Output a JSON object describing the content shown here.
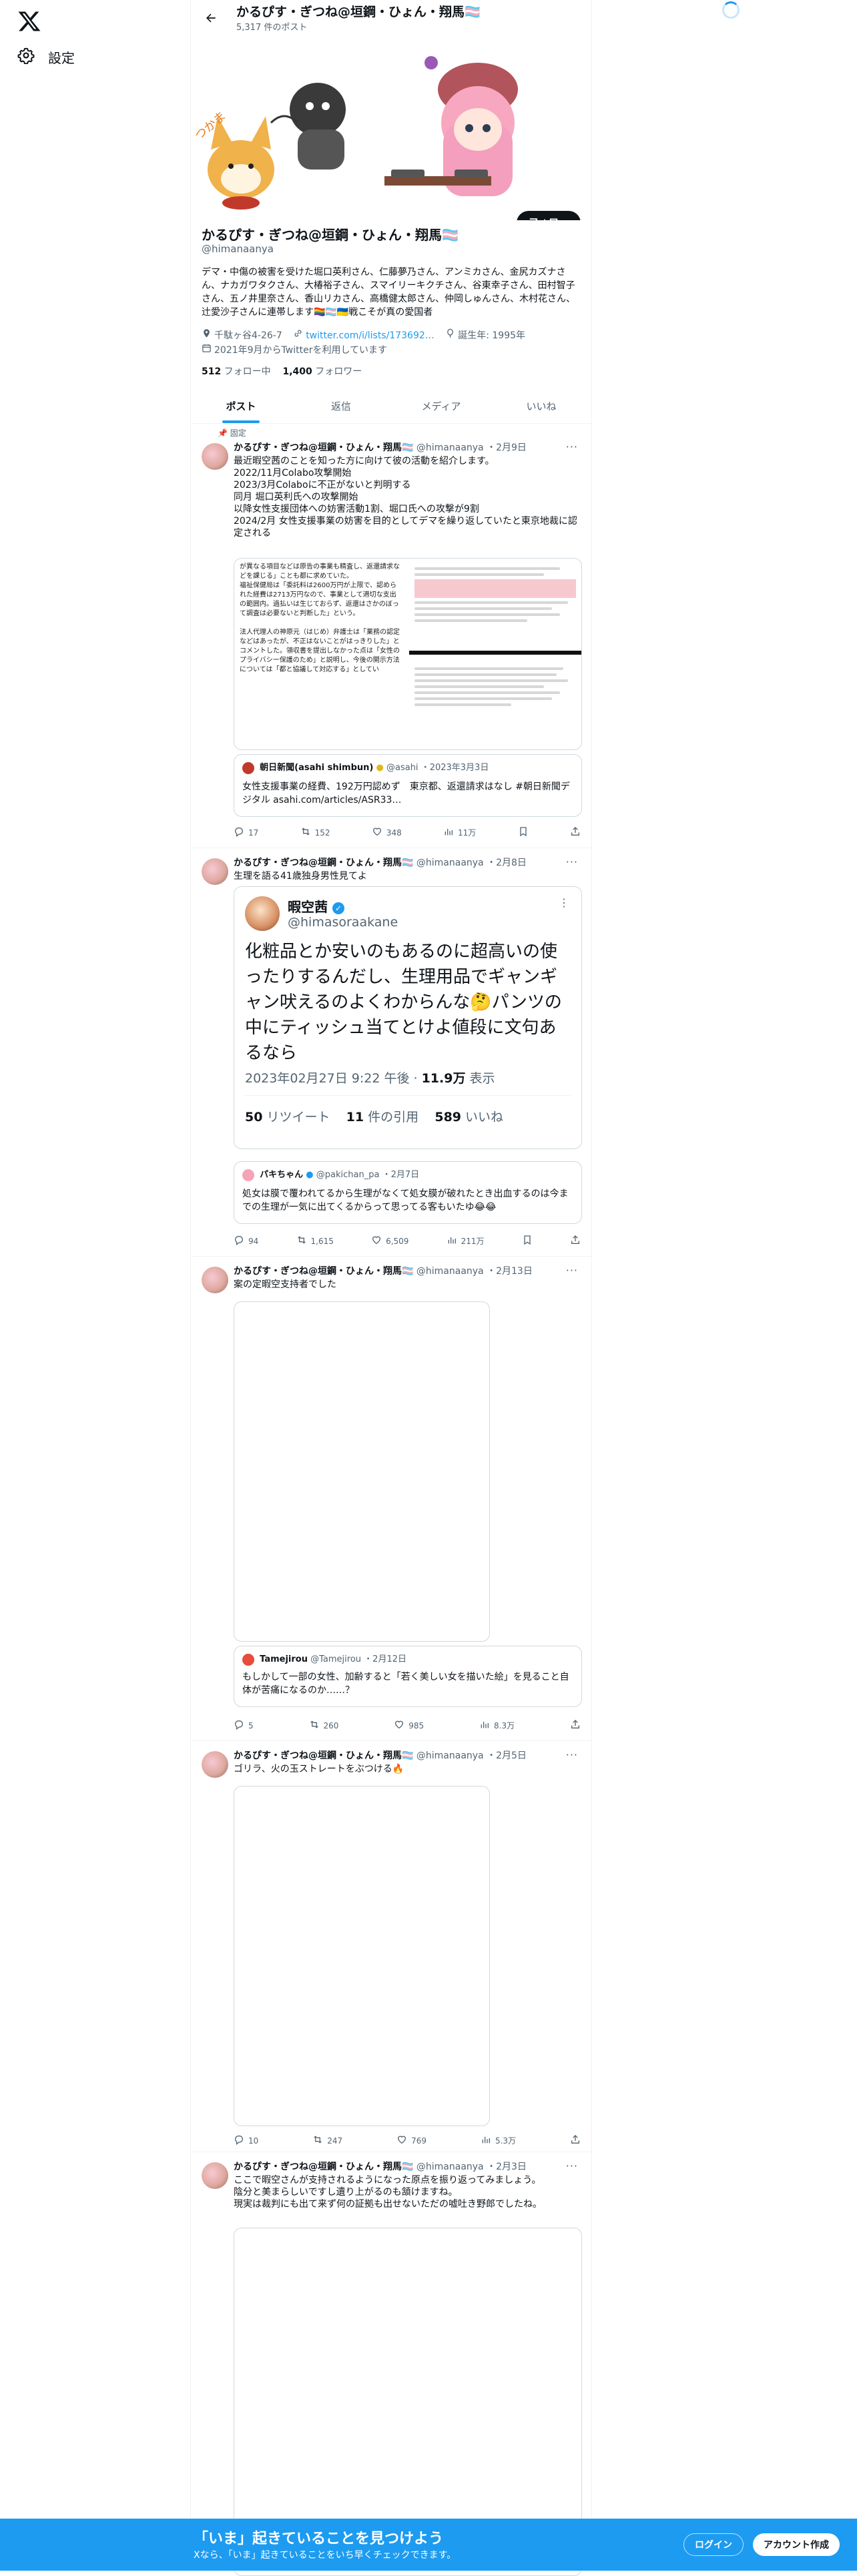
{
  "nav": {
    "settings_label": "設定"
  },
  "header": {
    "name": "かるぴす・ぎつね@垣鋼・ひょん・翔馬🏳️‍⚧️",
    "post_count": "5,317 件のポスト"
  },
  "profile": {
    "name": "かるぴす・ぎつね@垣鋼・ひょん・翔馬🏳️‍⚧️",
    "handle": "@himanaanya",
    "follow_label": "フォロー",
    "bio": "デマ・中傷の被害を受けた堀口英利さん、仁藤夢乃さん、アンミカさん、金尻カズナさん、ナカガワタクさん、大椿裕子さん、スマイリーキクチさん、谷東幸子さん、田村智子さん、五ノ井里奈さん、香山リカさん、高橋健太郎さん、仲岡しゅんさん、木村花さん、辻愛沙子さんに連帯します🏳️‍🌈🏳️‍⚧️🇺🇦戦こそが真の愛国者",
    "location": "千駄ヶ谷4-26-7",
    "website": "twitter.com/i/lists/173692…",
    "birthday": "誕生年: 1995年",
    "joined": "2021年9月からTwitterを利用しています",
    "following_count": "512",
    "following_label": " フォロー中",
    "followers_count": "1,400",
    "followers_label": " フォロワー"
  },
  "tabs": [
    "ポスト",
    "返信",
    "メディア",
    "いいね"
  ],
  "tweets": [
    {
      "pinned_label": "固定",
      "name": "かるぴす・ぎつね@垣鋼・ひょん・翔馬🏳️‍⚧️",
      "handle": "@himanaanya",
      "date": "・2月9日",
      "text": "最近暇空茜のことを知った方に向けて彼の活動を紹介します。\n2022/11月Colabo攻撃開始\n2023/3月Colaboに不正がないと判明する\n同月 堀口英利氏への攻撃開始\n以降女性支援団体への妨害活動1割、堀口氏への攻撃が9割\n2024/2月 女性支援事業の妨害を目的としてデマを繰り返していたと東京地裁に認定される",
      "media_left_text": "が異なる項目などは原告の事業も精査し、返還請求などを課じる」ことも都に求めていた。\n福祉保健局は「委託料は2600万円が上限で、認められた経費は2713万円なので、事業として適切な支出の範囲内。過払いは生じておらず、返還はさかのぼって調査は必要ないと判断した」という。\n\n法人代理人の神原元（はじめ）弁護士は「業務の認定などはあったが、不正はないことがはっきりした」とコメントした。領収書を提出しなかった点は「女性のプライバシー保護のため」と説明し、今後の開示方法については「都と協議して対応する」としてい",
      "quote_name": "朝日新聞(asahi shimbun)",
      "quote_handle": "@asahi",
      "quote_date": "・2023年3月3日",
      "quote_text": "女性支援事業の経費、192万円認めず　東京都、返還請求はなし #朝日新聞デジタル asahi.com/articles/ASR33…",
      "replies": "17",
      "reposts": "152",
      "likes": "348",
      "views": "11万"
    },
    {
      "name": "かるぴす・ぎつね@垣鋼・ひょん・翔馬🏳️‍⚧️",
      "handle": "@himanaanya",
      "date": "・2月8日",
      "text": "生理を語る41歳独身男性見てよ",
      "embed_name": "暇空茜",
      "embed_handle": "@himasoraakane",
      "embed_text": "化粧品とか安いのもあるのに超高いの使ったりするんだし、生理用品でギャンギャン吠えるのよくわからんな🤔パンツの中にティッシュ当てとけよ値段に文句あるなら",
      "embed_time": "2023年02月27日 9:22 午後 · ",
      "embed_views": "11.9万",
      "embed_views_label": " 表示",
      "embed_retweets": "50",
      "embed_retweets_label": " リツイート",
      "embed_quotes": "11",
      "embed_quotes_label": " 件の引用",
      "embed_likes": "589",
      "embed_likes_label": " いいね",
      "quote_name": "パキちゃん",
      "quote_handle": "@pakichan_pa",
      "quote_date": "・2月7日",
      "quote_text": "処女は膜で覆われてるから生理がなくて処女膜が破れたとき出血するのは今までの生理が一気に出てくるからって思ってる客もいたゆ😂😂",
      "replies": "94",
      "reposts": "1,615",
      "likes": "6,509",
      "views": "211万"
    },
    {
      "name": "かるぴす・ぎつね@垣鋼・ひょん・翔馬🏳️‍⚧️",
      "handle": "@himanaanya",
      "date": "・2月13日",
      "text": "案の定暇空支持者でした",
      "quote_name": "Tamejirou",
      "quote_handle": "@Tamejirou",
      "quote_date": "・2月12日",
      "quote_text": "もしかして一部の女性、加齢すると「若く美しい女を描いた絵」を見ること自体が苦痛になるのか……？",
      "replies": "5",
      "reposts": "260",
      "likes": "985",
      "views": "8.3万"
    },
    {
      "name": "かるぴす・ぎつね@垣鋼・ひょん・翔馬🏳️‍⚧️",
      "handle": "@himanaanya",
      "date": "・2月5日",
      "text": "ゴリラ、火の玉ストレートをぶつける🔥",
      "replies": "10",
      "reposts": "247",
      "likes": "769",
      "views": "5.3万"
    },
    {
      "name": "かるぴす・ぎつね@垣鋼・ひょん・翔馬🏳️‍⚧️",
      "handle": "@himanaanya",
      "date": "・2月3日",
      "text": "ここで暇空さんが支持されるようになった原点を振り返ってみましょう。\n陰分と美まらしいですし遺り上がるのも頷けますね。\n現実は裁判にも出て来ず何の証拠も出せないただの嘘吐き野郎でしたね。"
    }
  ],
  "bottom_bar": {
    "title": "「いま」起きていることを見つけよう",
    "subtitle": "Xなら、「いま」起きていることをいち早くチェックできます。",
    "login_label": "ログイン",
    "signup_label": "アカウント作成"
  },
  "colors": {
    "accent": "#1d9bf0",
    "text": "#0f1419",
    "muted": "#536471",
    "border": "#eff3f4"
  }
}
